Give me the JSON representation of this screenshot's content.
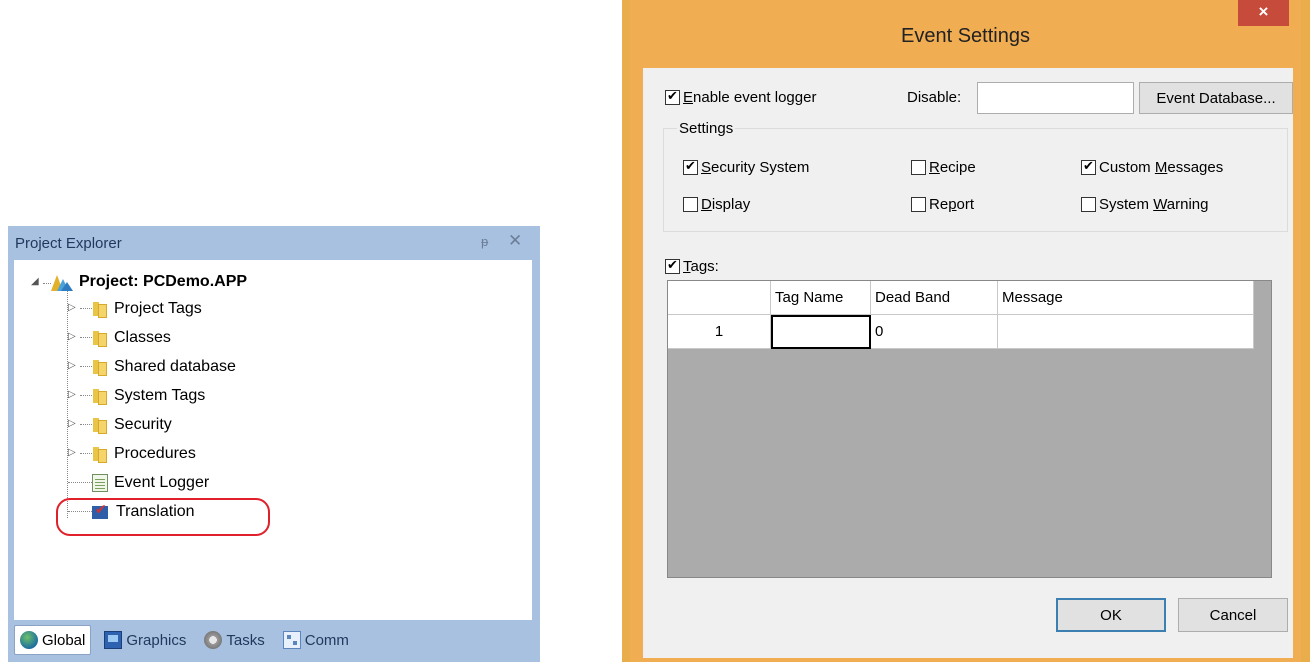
{
  "project_explorer": {
    "title": "Project Explorer",
    "pin_icon": "ᵽ",
    "close_icon": "✕",
    "tree": {
      "root_label": "Project: PCDemo.APP",
      "items": [
        {
          "label": "Project Tags",
          "icon": "folder-icon"
        },
        {
          "label": "Classes",
          "icon": "folder-icon"
        },
        {
          "label": "Shared database",
          "icon": "folder-icon"
        },
        {
          "label": "System Tags",
          "icon": "folder-icon"
        },
        {
          "label": "Security",
          "icon": "folder-icon"
        },
        {
          "label": "Procedures",
          "icon": "folder-icon"
        },
        {
          "label": "Event Logger",
          "icon": "event-log-icon"
        },
        {
          "label": "Translation",
          "icon": "translation-icon"
        }
      ]
    },
    "tabs": [
      {
        "label": "Global",
        "active": true
      },
      {
        "label": "Graphics"
      },
      {
        "label": "Tasks"
      },
      {
        "label": "Comm"
      }
    ]
  },
  "dialog": {
    "title": "Event Settings",
    "close_label": "×",
    "enable_label_first": "E",
    "enable_label_rest": "nable event logger",
    "disable_label": "Disable:",
    "disable_value": "",
    "event_db_button": "Event Database...",
    "settings_label": "Settings",
    "settings_options": {
      "security_a": "S",
      "security_b": "ecurity System",
      "recipe_a": "R",
      "recipe_b": "ecipe",
      "custom_a": "Custom ",
      "custom_b": "M",
      "custom_c": "essages",
      "display_a": "D",
      "display_b": "isplay",
      "report_a": "Re",
      "report_b": "p",
      "report_c": "ort",
      "warning_a": "System ",
      "warning_b": "W",
      "warning_c": "arning"
    },
    "tags_label_a": "T",
    "tags_label_b": "ags:",
    "grid": {
      "columns": [
        "Tag Name",
        "Dead Band",
        "Message"
      ],
      "rows": [
        {
          "index": "1",
          "tag_name": "",
          "dead_band": "0",
          "message": ""
        }
      ]
    },
    "ok_button": "OK",
    "cancel_button": "Cancel"
  }
}
